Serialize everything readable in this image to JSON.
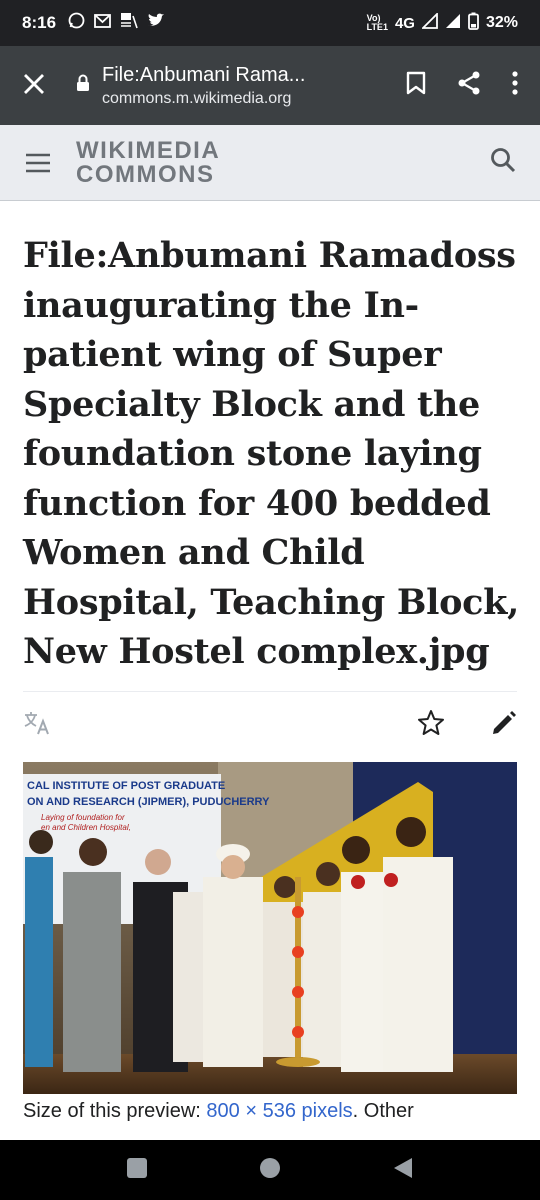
{
  "status_bar": {
    "time": "8:16",
    "network": "4G",
    "battery": "32%",
    "notification_icons": [
      "whatsapp-icon",
      "gmail-icon",
      "news-icon",
      "twitter-icon"
    ]
  },
  "browser": {
    "page_title": "File:Anbumani Rama...",
    "url": "commons.m.wikimedia.org"
  },
  "site": {
    "logo_line1": "WIKIMEDIA",
    "logo_line2": "COMMONS"
  },
  "page": {
    "heading": "File:Anbumani Ramadoss inaugurating the In-patient wing of Super Specialty Block and the foundation stone laying function for 400 bedded Women and Child Hospital, Teaching Block, New Hostel complex.jpg",
    "banner_line1": "CAL INSTITUTE OF POST GRADUATE",
    "banner_line2": "ON AND RESEARCH (JIPMER), PUDUCHERRY",
    "banner_line3": "Laying of foundation for",
    "banner_line4": "en and Children Hospital,",
    "caption_prefix": "Size of this preview: ",
    "caption_link": "800 × 536 pixels",
    "caption_suffix": ". Other"
  },
  "colors": {
    "status_bg": "#202124",
    "chrome_bg": "#3c4043",
    "header_bg": "#eaecf0",
    "link": "#3366cc",
    "logo_gray": "#72777d"
  }
}
